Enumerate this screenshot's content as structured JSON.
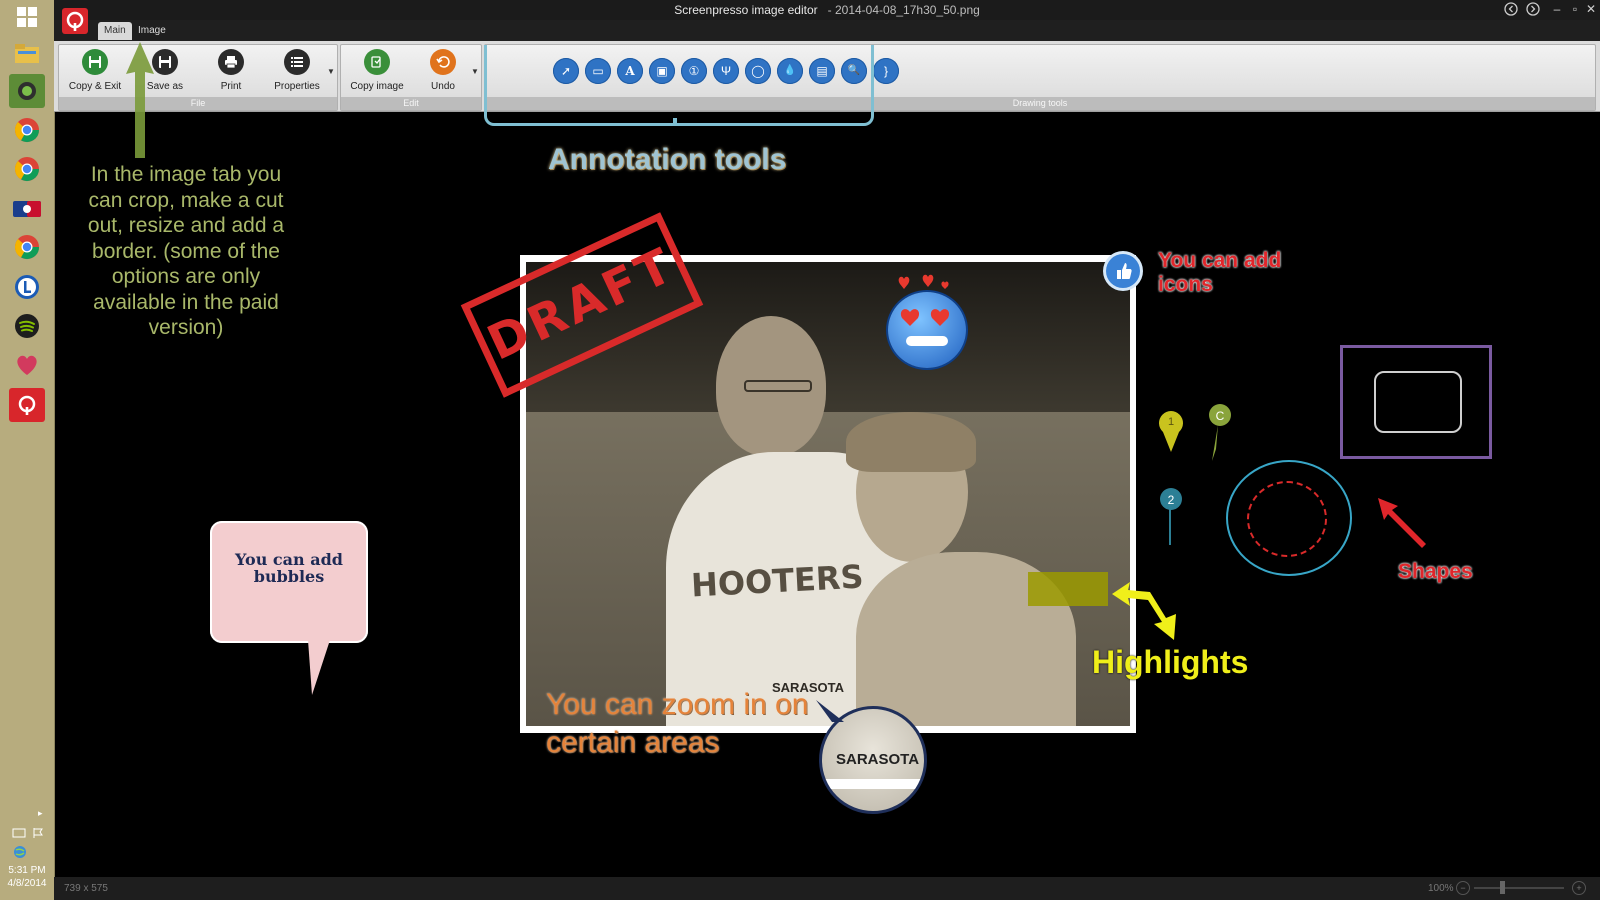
{
  "window": {
    "title": "Screenpresso image editor",
    "separator": "-",
    "filename": "2014-04-08_17h30_50.png"
  },
  "tabs": [
    {
      "label": "Main",
      "active": true
    },
    {
      "label": "Image",
      "active": false
    }
  ],
  "ribbon": {
    "file_group": {
      "label": "File",
      "buttons": [
        {
          "label": "Copy & Exit",
          "icon": "save-icon",
          "color": "#2e8b3a"
        },
        {
          "label": "Save as",
          "icon": "save-as-icon",
          "color": "#333333"
        },
        {
          "label": "Print",
          "icon": "print-icon",
          "color": "#333333"
        },
        {
          "label": "Properties",
          "icon": "list-icon",
          "color": "#333333"
        }
      ]
    },
    "edit_group": {
      "label": "Edit",
      "buttons": [
        {
          "label": "Copy image",
          "icon": "copy-icon",
          "color": "#3a8f3a"
        },
        {
          "label": "Undo",
          "icon": "undo-icon",
          "color": "#e0731c"
        }
      ]
    },
    "drawing_group": {
      "label": "Drawing tools",
      "tools": [
        "arrow-tool-icon",
        "rectangle-tool-icon",
        "text-tool-icon",
        "bubble-tool-icon",
        "number-tool-icon",
        "highlight-tool-icon",
        "ellipse-tool-icon",
        "blur-tool-icon",
        "image-tool-icon",
        "magnifier-tool-icon",
        "brace-tool-icon"
      ],
      "glyphs": [
        "➚",
        "▭",
        "A",
        "▣",
        "①",
        "Ψ",
        "◯",
        "💧",
        "▤",
        "🔍",
        "}"
      ]
    }
  },
  "annotations": {
    "annotation_tools": "Annotation tools",
    "image_tab_note": "In the image tab you can crop, make a cut out, resize and add a border. (some of the options are only available in the paid version)",
    "draft_stamp": "DRAFT",
    "add_icons": "You can add icons",
    "add_bubbles": "You can add bubbles",
    "highlights": "Highlights",
    "zoom": "You can zoom in on certain areas",
    "shapes": "Shapes",
    "pin_1": "1",
    "pin_2": "2",
    "pin_c": "C",
    "magnifier_text": "SARASOTA",
    "shirt_text": "HOOTERS",
    "shirt_text_2": "SARASOTA"
  },
  "colors": {
    "red": "#e0262b",
    "yellow": "#f0ef1a",
    "green_text": "#a9b86a",
    "orange": "#e5833a",
    "purple": "#7a5aa0",
    "cyan": "#38a6c7"
  },
  "status": {
    "dimensions": "739 x 575",
    "zoom": "100%"
  },
  "taskbar": {
    "time": "5:31 PM",
    "date": "4/8/2014"
  }
}
